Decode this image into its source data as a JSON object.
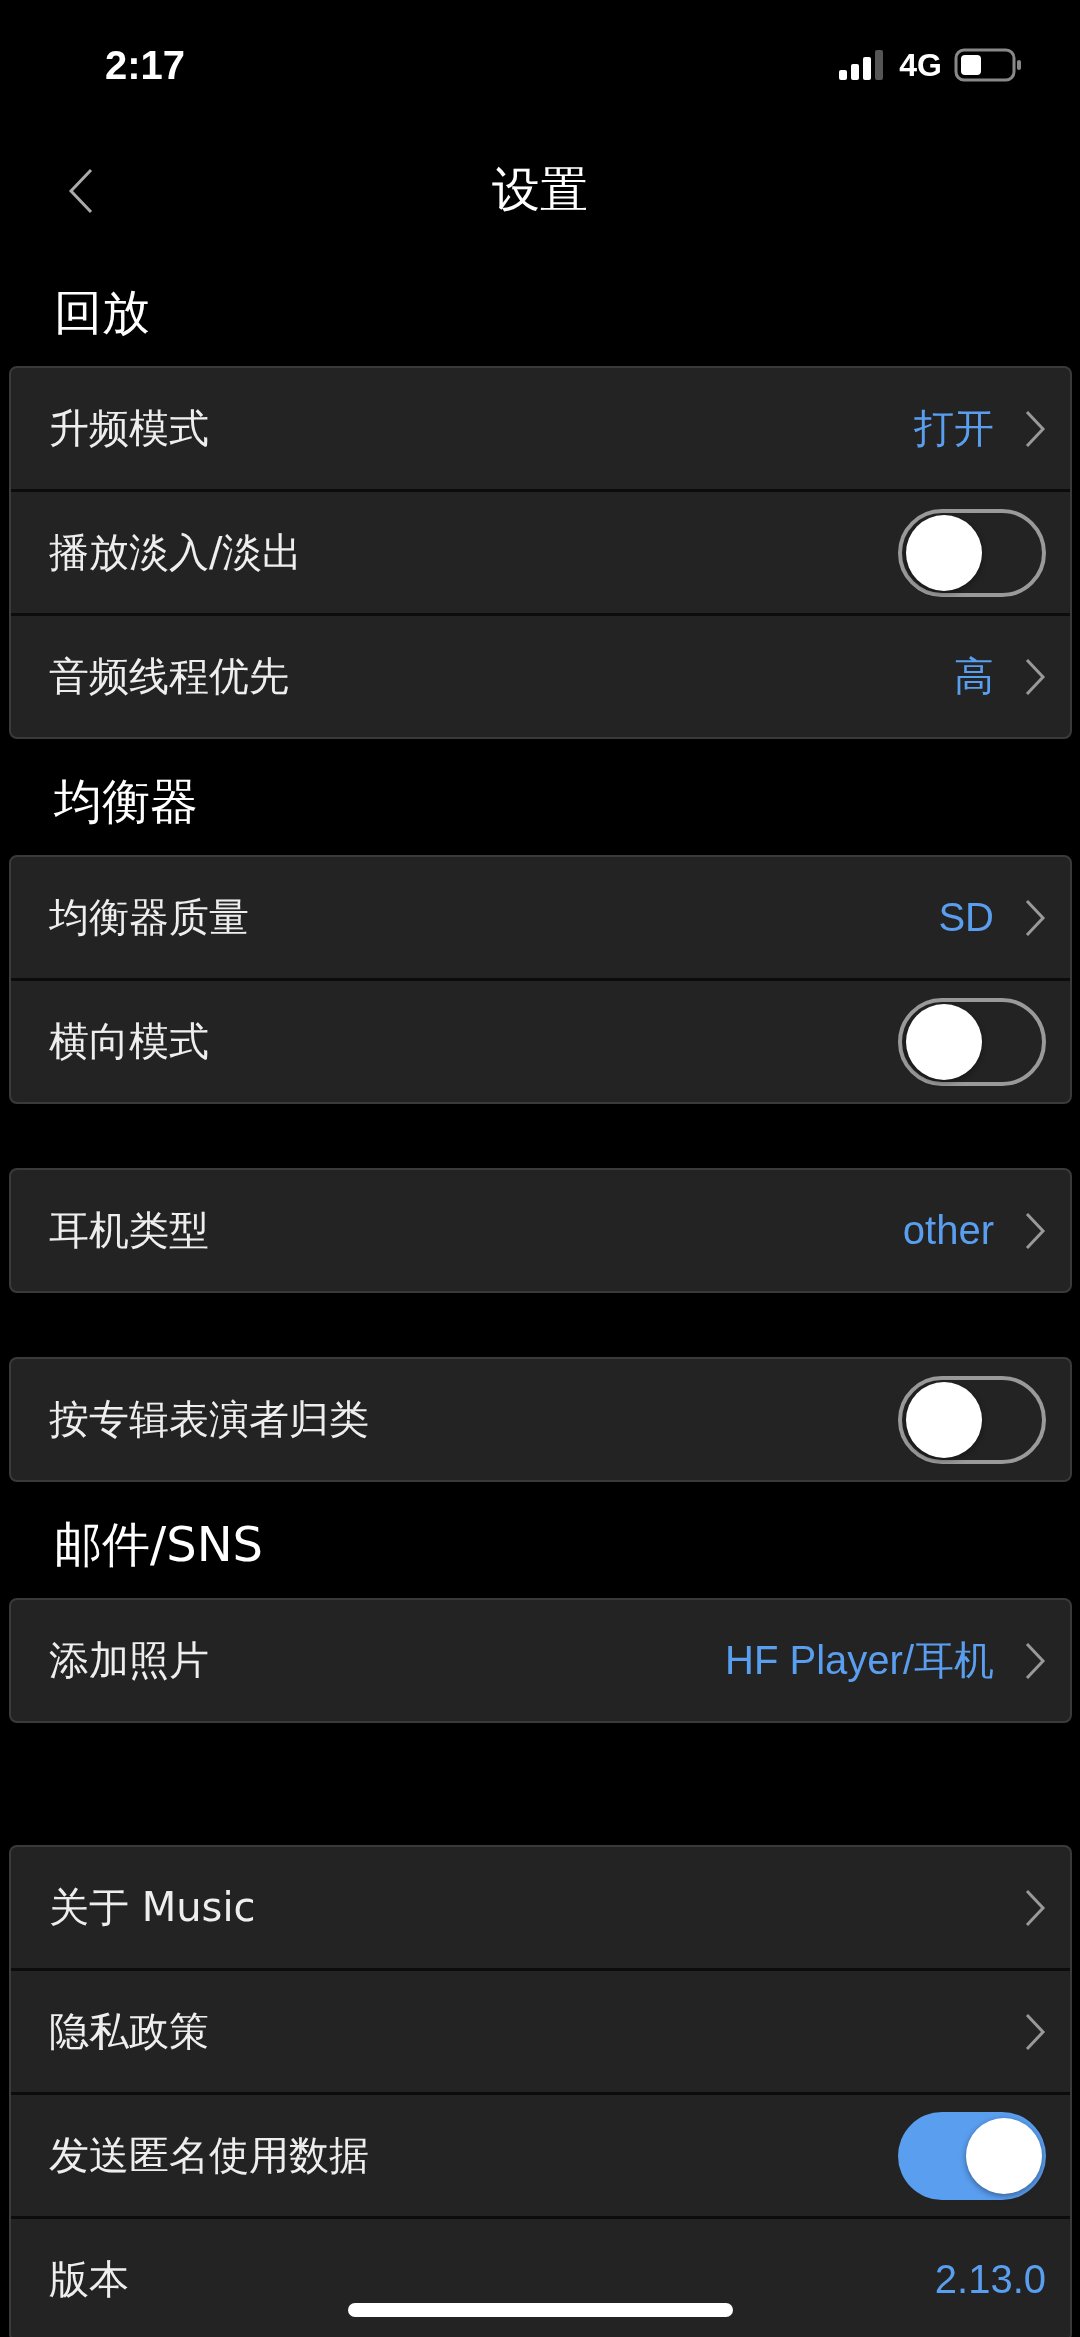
{
  "status_bar": {
    "time": "2:17",
    "network": "4G"
  },
  "nav": {
    "title": "设置"
  },
  "groups": [
    {
      "header": "回放",
      "rows": [
        {
          "kind": "link",
          "label": "升频模式",
          "value": "打开"
        },
        {
          "kind": "toggle",
          "label": "播放淡入/淡出",
          "on": false
        },
        {
          "kind": "link",
          "label": "音频线程优先",
          "value": "高"
        }
      ]
    },
    {
      "header": "均衡器",
      "rows": [
        {
          "kind": "link",
          "label": "均衡器质量",
          "value": "SD"
        },
        {
          "kind": "toggle",
          "label": "横向模式",
          "on": false
        }
      ]
    },
    {
      "rows": [
        {
          "kind": "link",
          "label": "耳机类型",
          "value": "other"
        }
      ]
    },
    {
      "rows": [
        {
          "kind": "toggle",
          "label": "按专辑表演者归类",
          "on": false
        }
      ]
    },
    {
      "header": "邮件/SNS",
      "rows": [
        {
          "kind": "link",
          "label": "添加照片",
          "value": "HF Player/耳机"
        }
      ]
    },
    {
      "rows": [
        {
          "kind": "link",
          "label": "关于 Music"
        },
        {
          "kind": "link",
          "label": "隐私政策"
        },
        {
          "kind": "toggle",
          "label": "发送匿名使用数据",
          "on": true
        },
        {
          "kind": "info",
          "label": "版本",
          "value": "2.13.0"
        }
      ]
    }
  ]
}
